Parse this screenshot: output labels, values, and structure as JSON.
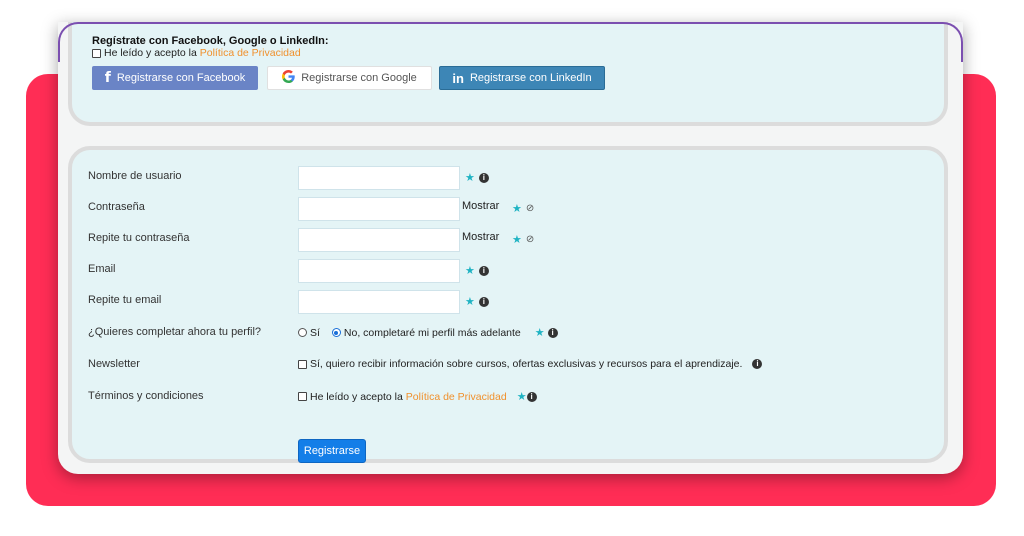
{
  "social": {
    "title": "Regístrate con Facebook, Google o LinkedIn:",
    "privacy_prefix": "He leído y acepto la",
    "privacy_link": "Política de Privacidad",
    "facebook_label": "Registrarse con Facebook",
    "google_label": "Registrarse con Google",
    "linkedin_label": "Registrarse con LinkedIn"
  },
  "form": {
    "username_label": "Nombre de usuario",
    "password_label": "Contraseña",
    "password_repeat_label": "Repite tu contraseña",
    "email_label": "Email",
    "email_repeat_label": "Repite tu email",
    "profile_label": "¿Quieres completar ahora tu perfil?",
    "profile_yes": "Sí",
    "profile_no": "No, completaré mi perfil más adelante",
    "newsletter_label": "Newsletter",
    "newsletter_text": "Sí, quiero recibir información sobre cursos, ofertas exclusivas y recursos para el aprendizaje.",
    "terms_label": "Términos y condiciones",
    "terms_prefix": "He leído y acepto la",
    "terms_link": "Política de Privacidad",
    "show_label": "Mostrar",
    "submit_label": "Registrarse"
  },
  "icons": {
    "required": "star-icon",
    "info": "info-icon",
    "eye": "eye-slash-icon"
  },
  "colors": {
    "accent_red": "#ff2d55",
    "panel": "#e4f4f6",
    "link": "#f0902c",
    "primary": "#137ee8",
    "facebook": "#6a84c6",
    "linkedin": "#3d86b6",
    "required_star": "#1fb3c3"
  }
}
